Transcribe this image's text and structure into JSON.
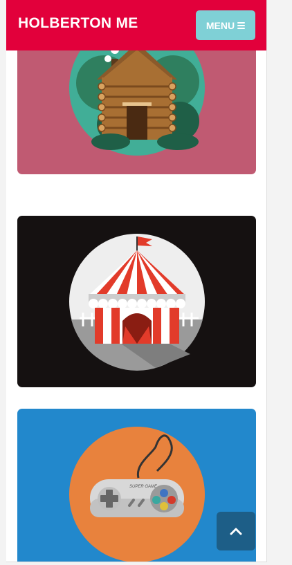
{
  "header": {
    "brand": "HOLBERTON ME",
    "menu_label": "MENU"
  },
  "cards": [
    {
      "name": "log-cabin",
      "background": "#c05a72",
      "circle": "#41ae97"
    },
    {
      "name": "circus-tent",
      "background": "#151111",
      "circle": "#eeeeee"
    },
    {
      "name": "game-controller",
      "background": "#2288cc",
      "circle": "#e8823d"
    }
  ],
  "icons": {
    "menu": "hamburger-icon",
    "back_to_top": "chevron-up-icon"
  },
  "controller_text": "SUPER GAME",
  "colors": {
    "header": "#e2003b",
    "menu_button": "#7fd0d6",
    "back_to_top": "#1d5e87"
  }
}
